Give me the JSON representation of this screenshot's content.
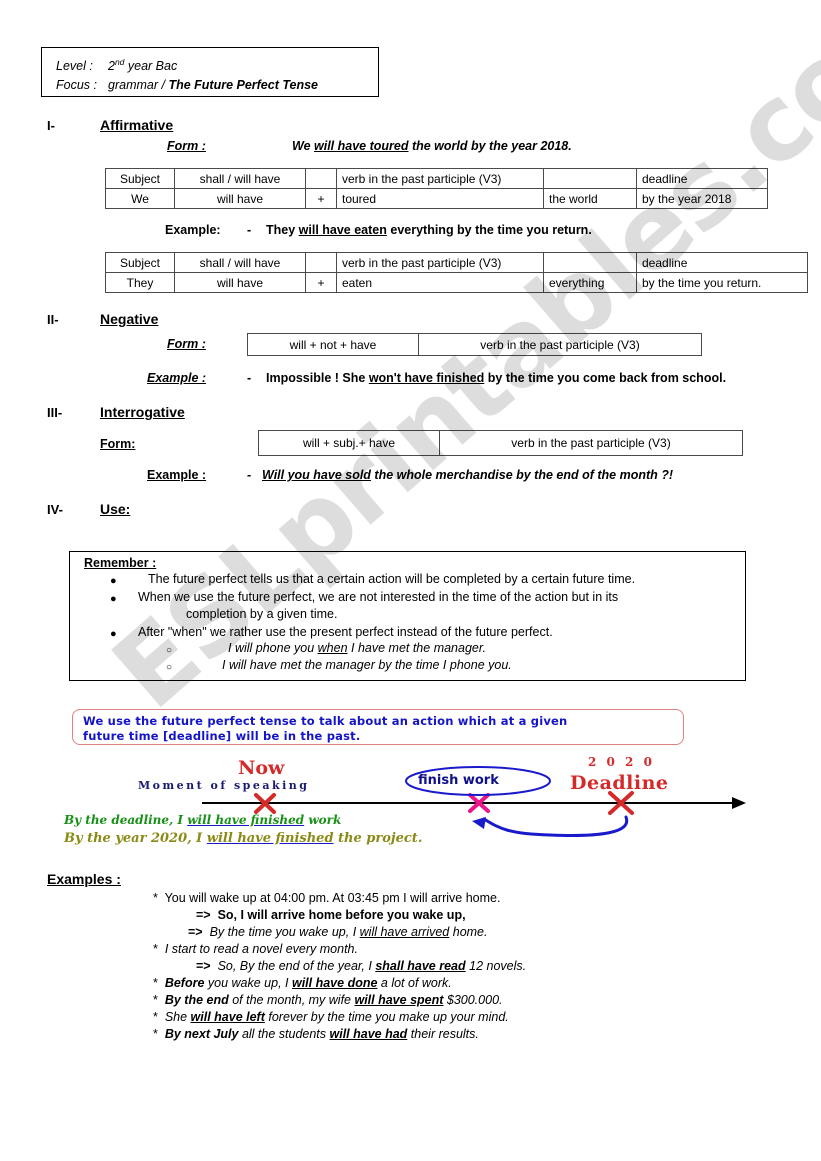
{
  "header": {
    "level_label": "Level :",
    "level_value": "2",
    "level_sup": "nd",
    "level_value2": " year Bac",
    "focus_label": "Focus :",
    "focus_value": "grammar  /  ",
    "focus_bold": "The Future Perfect Tense"
  },
  "sections": {
    "affirmative": {
      "num": "I-",
      "title": "Affirmative",
      "form_label": "Form :",
      "form_sentence_pre": "We  ",
      "form_sentence_u": "will have toured",
      "form_sentence_post": "  the world by the year 2018.",
      "example_label": "Example:",
      "example_dash": "-",
      "example_pre": "They  ",
      "example_u": "will have eaten",
      "example_post": "  everything by the time you return."
    },
    "negative": {
      "num": "II-",
      "title": "Negative",
      "form_label": "Form :",
      "example_label": "Example :",
      "example_dash": "-",
      "example_pre": "Impossible !  She ",
      "example_u": "won't have finished",
      "example_post": " by the time you come back from school."
    },
    "interrogative": {
      "num": "III-",
      "title": "Interrogative",
      "form_label": "Form:",
      "example_label": "Example :",
      "example_dash": "-",
      "example_u": "Will you have sold",
      "example_post": " the whole merchandise by the end of the month  ?!"
    },
    "use": {
      "num": "IV-",
      "title": "Use:"
    }
  },
  "table1": {
    "headers": [
      "Subject",
      "shall / will have",
      "",
      "verb in the past participle (V3)",
      "",
      "deadline"
    ],
    "row": [
      "We",
      "will have",
      "+",
      "toured",
      "the world",
      "by the year 2018"
    ]
  },
  "table2": {
    "headers": [
      "Subject",
      "shall / will have",
      "",
      "verb in the past participle (V3)",
      "",
      "deadline"
    ],
    "row": [
      "They",
      "will have",
      "+",
      "eaten",
      "everything",
      "by the time you return."
    ]
  },
  "neg_form_table": {
    "cells": [
      "will + not + have",
      "verb in the past participle (V3)"
    ]
  },
  "int_form_table": {
    "cells": [
      "will + subj.+ have",
      "verb in the past participle (V3)"
    ]
  },
  "remember": {
    "title": "Remember :",
    "bullets": [
      "The future perfect tells us that a certain action will be completed by a certain future time.",
      "When we use the future perfect, we are not interested in the time of the action but in its",
      "completion by a given time.",
      "After \"when\" we rather use the present perfect instead of the future perfect."
    ],
    "sub_bullets": [
      {
        "pre": "I  will phone you ",
        "u": "when",
        "post": "   I have met the manager."
      },
      {
        "pre": "I will have met the manager by the time I phone you.",
        "u": "",
        "post": ""
      }
    ]
  },
  "blue_box": {
    "line1": "We use the future perfect tense to talk about an action which at a given",
    "line2": "future time [deadline] will be in the past."
  },
  "timeline": {
    "now": "Now",
    "moment": "Moment  of  speaking",
    "finish_work": "finish work",
    "year": "2 0 2 0",
    "deadline": "Deadline",
    "sentence1_pre": "By the deadline, I ",
    "sentence1_u": "will have finished",
    "sentence1_post": " work",
    "sentence2_pre": "By the year 2020, I ",
    "sentence2_u": "will have finished",
    "sentence2_post": " the project."
  },
  "examples": {
    "title": "Examples :",
    "items": [
      {
        "marker": "*",
        "pre": "You will wake up at 04:00 pm.   At 03:45 pm I will arrive home.",
        "u": "",
        "post": "",
        "style": "plain"
      },
      {
        "marker": "=>",
        "pre": "So, I will arrive home before you wake up,",
        "u": "",
        "post": "",
        "style": "bold"
      },
      {
        "marker": "=>",
        "pre": "By the time   you wake up,  I ",
        "u": "will have arrived",
        "post": " home.",
        "style": "italic"
      },
      {
        "marker": "*",
        "pre": "I start to read a novel every month.",
        "u": "",
        "post": "",
        "style": "italic"
      },
      {
        "marker": "=>",
        "pre": "So, By the end of the year, I ",
        "u": "shall have read",
        "post": " 12 novels.",
        "style": "italic"
      },
      {
        "marker": "*",
        "pre": "Before",
        "u": "",
        "post": " you wake up, I ",
        "u2": "will have done",
        "post2": " a lot of work.",
        "style": "mixed"
      },
      {
        "marker": "*",
        "pre": "By the end",
        "u": "",
        "post": " of the month, my wife ",
        "u2": "will have spent",
        "post2": " $300.000.",
        "style": "mixed"
      },
      {
        "marker": "*",
        "pre": "She ",
        "u": "",
        "post": "",
        "u2": "will have left",
        "post2": " forever by the time you make up your mind.",
        "style": "mixed2"
      },
      {
        "marker": "*",
        "pre": "By next July",
        "u": "",
        "post": " all the students ",
        "u2": "will have had",
        "post2": " their results.",
        "style": "mixed"
      }
    ]
  },
  "watermark": {
    "text": "ESLprintables.com"
  },
  "colors": {
    "red": "#d42a2a",
    "navy": "#1a1a6e",
    "blue": "#1414c8",
    "green": "#169016",
    "olive": "#8a8a16",
    "magenta": "#e8178c",
    "box_border_red": "#e08080"
  }
}
